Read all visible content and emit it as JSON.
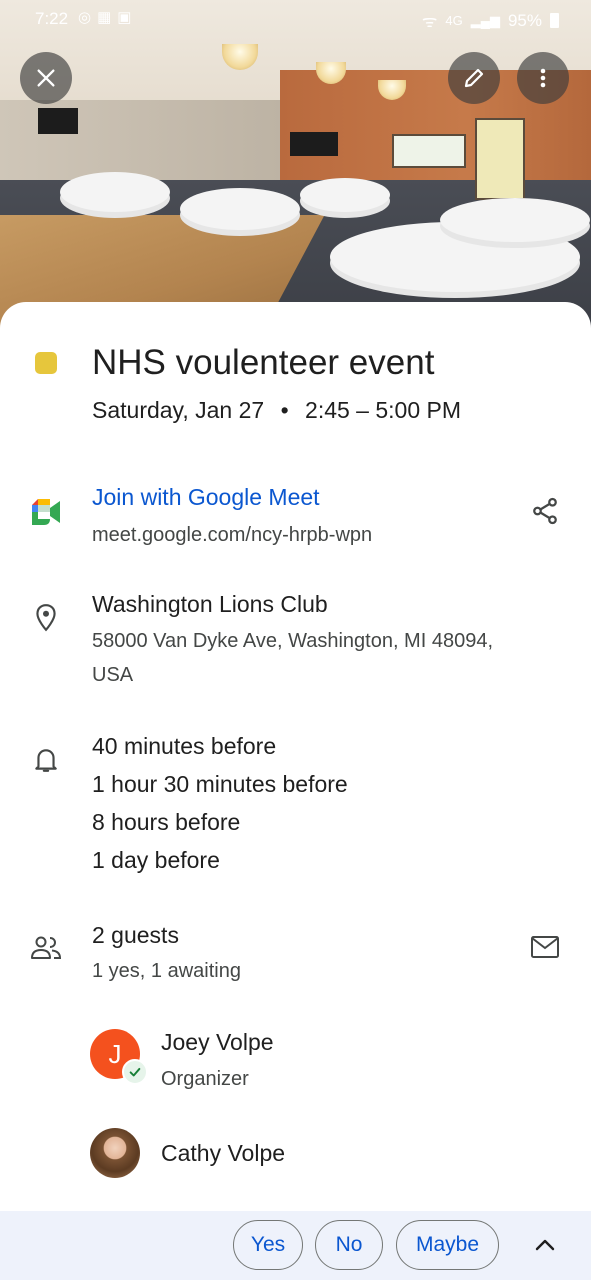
{
  "status_bar": {
    "time": "7:22",
    "network": "4G",
    "battery": "95%"
  },
  "header": {
    "close_icon": "close-icon",
    "edit_icon": "pencil-icon",
    "more_icon": "more-vert-icon"
  },
  "event": {
    "color": "#e6c63c",
    "title": "NHS voulenteer event",
    "date": "Saturday, Jan 27",
    "separator": "•",
    "time_range": "2:45 – 5:00 PM"
  },
  "meet": {
    "label": "Join with Google Meet",
    "url": "meet.google.com/ncy-hrpb-wpn"
  },
  "location": {
    "name": "Washington Lions Club",
    "address_line1": "58000 Van Dyke Ave, Washington, MI 48094,",
    "address_line2": "USA"
  },
  "notifications": [
    "40 minutes before",
    "1 hour 30 minutes before",
    "8 hours before",
    "1 day before"
  ],
  "guests": {
    "summary": "2 guests",
    "status": "1 yes, 1 awaiting",
    "list": [
      {
        "initial": "J",
        "name": "Joey Volpe",
        "role": "Organizer"
      },
      {
        "name": "Cathy Volpe"
      }
    ]
  },
  "rsvp": {
    "yes": "Yes",
    "no": "No",
    "maybe": "Maybe"
  },
  "colors": {
    "accent": "#0b57d0",
    "rsvp_bar": "#eef2fb",
    "organizer_avatar": "#f4511e"
  }
}
